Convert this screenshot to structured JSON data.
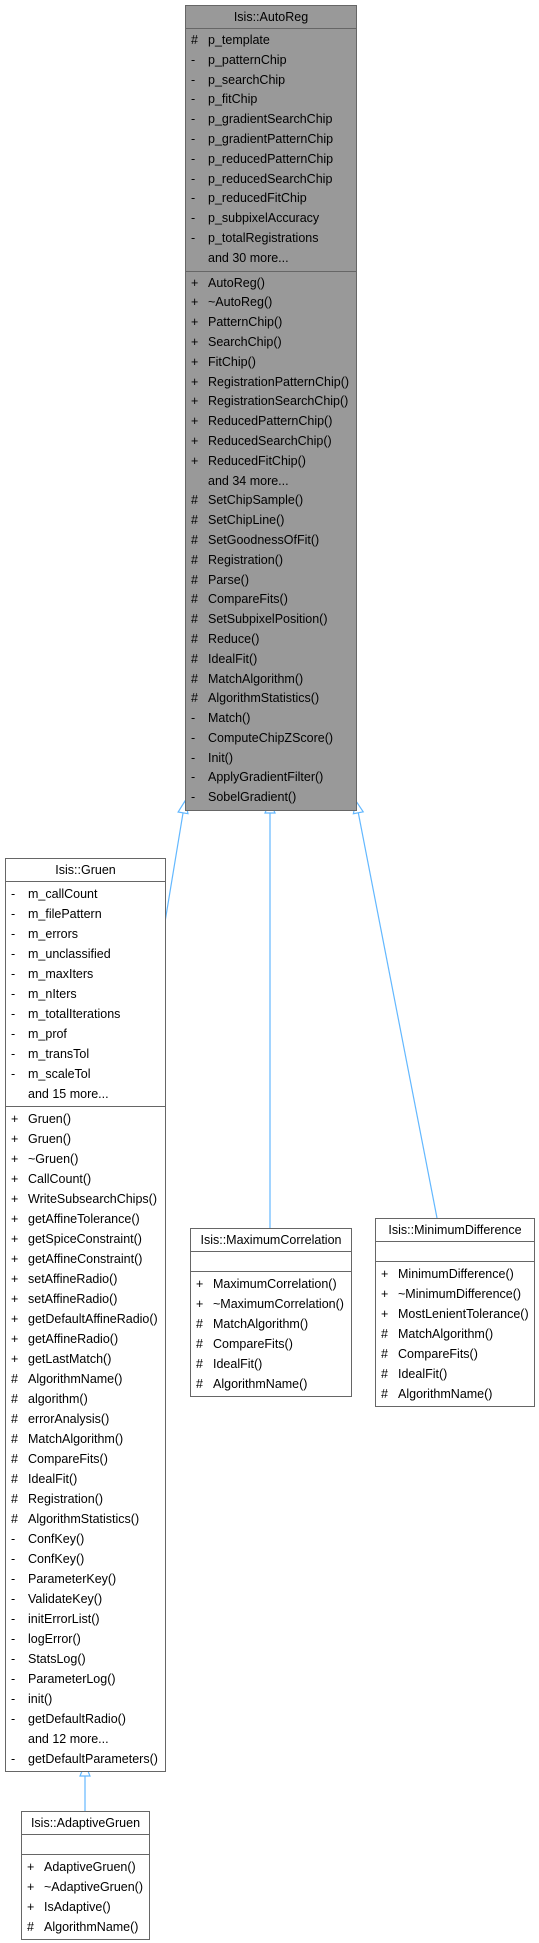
{
  "colors": {
    "base_fill": "#999999",
    "box_border": "#666666",
    "edge": "#63b8ff"
  },
  "classes": [
    {
      "id": "autoreg",
      "name": "Isis::AutoReg",
      "highlighted": true,
      "attributes": [
        [
          "#",
          "p_template"
        ],
        [
          "-",
          "p_patternChip"
        ],
        [
          "-",
          "p_searchChip"
        ],
        [
          "-",
          "p_fitChip"
        ],
        [
          "-",
          "p_gradientSearchChip"
        ],
        [
          "-",
          "p_gradientPatternChip"
        ],
        [
          "-",
          "p_reducedPatternChip"
        ],
        [
          "-",
          "p_reducedSearchChip"
        ],
        [
          "-",
          "p_reducedFitChip"
        ],
        [
          "-",
          "p_subpixelAccuracy"
        ],
        [
          "-",
          "p_totalRegistrations"
        ],
        [
          "",
          "and 30 more..."
        ]
      ],
      "methods": [
        [
          "+",
          "AutoReg()"
        ],
        [
          "+",
          "~AutoReg()"
        ],
        [
          "+",
          "PatternChip()"
        ],
        [
          "+",
          "SearchChip()"
        ],
        [
          "+",
          "FitChip()"
        ],
        [
          "+",
          "RegistrationPatternChip()"
        ],
        [
          "+",
          "RegistrationSearchChip()"
        ],
        [
          "+",
          "ReducedPatternChip()"
        ],
        [
          "+",
          "ReducedSearchChip()"
        ],
        [
          "+",
          "ReducedFitChip()"
        ],
        [
          "",
          "and 34 more..."
        ],
        [
          "#",
          "SetChipSample()"
        ],
        [
          "#",
          "SetChipLine()"
        ],
        [
          "#",
          "SetGoodnessOfFit()"
        ],
        [
          "#",
          "Registration()"
        ],
        [
          "#",
          "Parse()"
        ],
        [
          "#",
          "CompareFits()"
        ],
        [
          "#",
          "SetSubpixelPosition()"
        ],
        [
          "#",
          "Reduce()"
        ],
        [
          "#",
          "IdealFit()"
        ],
        [
          "#",
          "MatchAlgorithm()"
        ],
        [
          "#",
          "AlgorithmStatistics()"
        ],
        [
          "-",
          "Match()"
        ],
        [
          "-",
          "ComputeChipZScore()"
        ],
        [
          "-",
          "Init()"
        ],
        [
          "-",
          "ApplyGradientFilter()"
        ],
        [
          "-",
          "SobelGradient()"
        ]
      ]
    },
    {
      "id": "gruen",
      "name": "Isis::Gruen",
      "parent": "autoreg",
      "attributes": [
        [
          "-",
          "m_callCount"
        ],
        [
          "-",
          "m_filePattern"
        ],
        [
          "-",
          "m_errors"
        ],
        [
          "-",
          "m_unclassified"
        ],
        [
          "-",
          "m_maxIters"
        ],
        [
          "-",
          "m_nIters"
        ],
        [
          "-",
          "m_totalIterations"
        ],
        [
          "-",
          "m_prof"
        ],
        [
          "-",
          "m_transTol"
        ],
        [
          "-",
          "m_scaleTol"
        ],
        [
          "",
          "and 15 more..."
        ]
      ],
      "methods": [
        [
          "+",
          "Gruen()"
        ],
        [
          "+",
          "Gruen()"
        ],
        [
          "+",
          "~Gruen()"
        ],
        [
          "+",
          "CallCount()"
        ],
        [
          "+",
          "WriteSubsearchChips()"
        ],
        [
          "+",
          "getAffineTolerance()"
        ],
        [
          "+",
          "getSpiceConstraint()"
        ],
        [
          "+",
          "getAffineConstraint()"
        ],
        [
          "+",
          "setAffineRadio()"
        ],
        [
          "+",
          "setAffineRadio()"
        ],
        [
          "+",
          "getDefaultAffineRadio()"
        ],
        [
          "+",
          "getAffineRadio()"
        ],
        [
          "+",
          "getLastMatch()"
        ],
        [
          "#",
          "AlgorithmName()"
        ],
        [
          "#",
          "algorithm()"
        ],
        [
          "#",
          "errorAnalysis()"
        ],
        [
          "#",
          "MatchAlgorithm()"
        ],
        [
          "#",
          "CompareFits()"
        ],
        [
          "#",
          "IdealFit()"
        ],
        [
          "#",
          "Registration()"
        ],
        [
          "#",
          "AlgorithmStatistics()"
        ],
        [
          "-",
          "ConfKey()"
        ],
        [
          "-",
          "ConfKey()"
        ],
        [
          "-",
          "ParameterKey()"
        ],
        [
          "-",
          "ValidateKey()"
        ],
        [
          "-",
          "initErrorList()"
        ],
        [
          "-",
          "logError()"
        ],
        [
          "-",
          "StatsLog()"
        ],
        [
          "-",
          "ParameterLog()"
        ],
        [
          "-",
          "init()"
        ],
        [
          "-",
          "getDefaultRadio()"
        ],
        [
          "",
          "and 12 more..."
        ],
        [
          "-",
          "getDefaultParameters()"
        ]
      ]
    },
    {
      "id": "maxcorr",
      "name": "Isis::MaximumCorrelation",
      "parent": "autoreg",
      "attributes": [],
      "methods": [
        [
          "+",
          "MaximumCorrelation()"
        ],
        [
          "+",
          "~MaximumCorrelation()"
        ],
        [
          "#",
          "MatchAlgorithm()"
        ],
        [
          "#",
          "CompareFits()"
        ],
        [
          "#",
          "IdealFit()"
        ],
        [
          "#",
          "AlgorithmName()"
        ]
      ]
    },
    {
      "id": "mindiff",
      "name": "Isis::MinimumDifference",
      "parent": "autoreg",
      "attributes": [],
      "methods": [
        [
          "+",
          "MinimumDifference()"
        ],
        [
          "+",
          "~MinimumDifference()"
        ],
        [
          "+",
          "MostLenientTolerance()"
        ],
        [
          "#",
          "MatchAlgorithm()"
        ],
        [
          "#",
          "CompareFits()"
        ],
        [
          "#",
          "IdealFit()"
        ],
        [
          "#",
          "AlgorithmName()"
        ]
      ]
    },
    {
      "id": "adaptive",
      "name": "Isis::AdaptiveGruen",
      "parent": "gruen",
      "attributes": [],
      "methods": [
        [
          "+",
          "AdaptiveGruen()"
        ],
        [
          "+",
          "~AdaptiveGruen()"
        ],
        [
          "+",
          "IsAdaptive()"
        ],
        [
          "#",
          "AlgorithmName()"
        ]
      ]
    }
  ]
}
